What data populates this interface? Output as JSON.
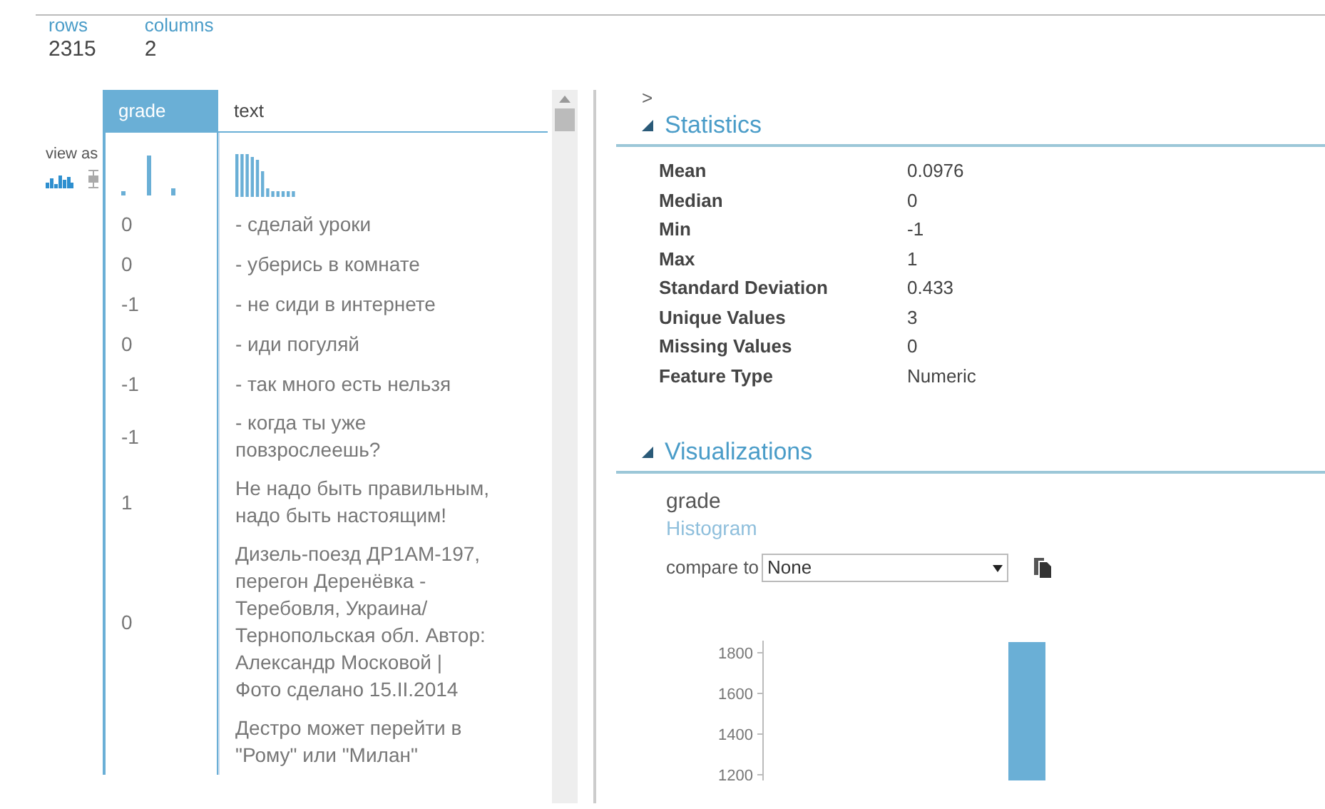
{
  "summary": [
    {
      "label": "rows",
      "value": "2315"
    },
    {
      "label": "columns",
      "value": "2"
    }
  ],
  "view_as": {
    "label": "view as",
    "modes": [
      {
        "kind": "histogram",
        "selected": true
      },
      {
        "kind": "boxplot",
        "selected": false
      }
    ]
  },
  "table": {
    "columns": [
      {
        "label": "grade",
        "selected": true,
        "kind": "numeric"
      },
      {
        "label": "text",
        "selected": false,
        "kind": "text"
      }
    ],
    "rows": [
      [
        "0",
        "- сделай уроки"
      ],
      [
        "0",
        "- уберись в комнате"
      ],
      [
        "-1",
        "- не сиди в интернете"
      ],
      [
        "0",
        "- иди погуляй"
      ],
      [
        "-1",
        "- так много есть нельзя"
      ],
      [
        "-1",
        "- когда ты уже повзрослеешь?"
      ],
      [
        "1",
        "Не надо быть правильным, надо быть настоящим!"
      ],
      [
        "0",
        "Дизель-поезд ДР1АМ-197, перегон Деренёвка - Теребовля, Украина/Тернопольская обл. Автор: Александр Московой | Фото сделано 15.II.2014"
      ],
      [
        "",
        "Дестро может перейти в \"Рому\" или \"Милан\""
      ]
    ]
  },
  "panel": {
    "toggle": ">",
    "statistics": {
      "title": "Statistics",
      "expanded": true,
      "items": [
        {
          "label": "Mean",
          "value": "0.0976"
        },
        {
          "label": "Median",
          "value": "0"
        },
        {
          "label": "Min",
          "value": "-1"
        },
        {
          "label": "Max",
          "value": "1"
        },
        {
          "label": "Standard Deviation",
          "value": "0.433"
        },
        {
          "label": "Unique Values",
          "value": "3"
        },
        {
          "label": "Missing Values",
          "value": "0"
        },
        {
          "label": "Feature Type",
          "value": "Numeric"
        }
      ]
    },
    "visualizations": {
      "title": "Visualizations",
      "expanded": true,
      "column": "grade",
      "chart_kind": "Histogram",
      "compare_label": "compare to",
      "compare_value": "None",
      "axis_labels": [
        "1800",
        "1600",
        "1400",
        "1200"
      ]
    }
  }
}
